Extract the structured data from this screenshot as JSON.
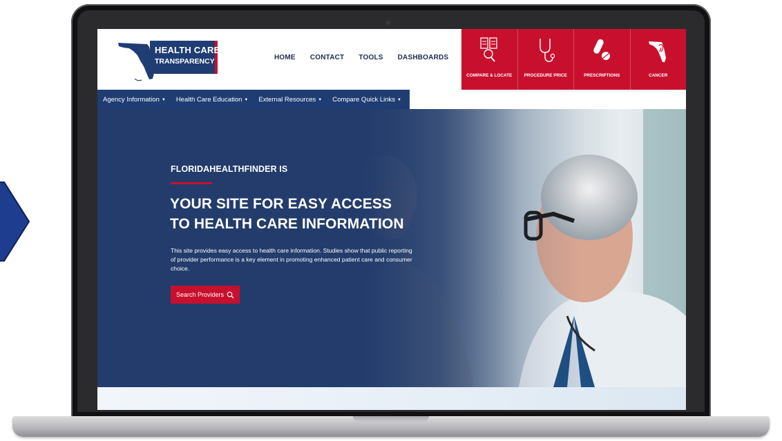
{
  "header": {
    "logo": {
      "line1": "HEALTH CARE",
      "line2": "TRANSPARENCY"
    },
    "nav": [
      "HOME",
      "CONTACT",
      "TOOLS",
      "DASHBOARDS"
    ],
    "quick_links": [
      {
        "label": "COMPARE & LOCATE",
        "icon": "compare-locate-icon"
      },
      {
        "label": "PROCEDURE PRICE",
        "icon": "stethoscope-icon"
      },
      {
        "label": "PRESCRIPTIONS",
        "icon": "pill-icon"
      },
      {
        "label": "CANCER",
        "icon": "florida-ribbon-icon"
      }
    ]
  },
  "subnav": [
    {
      "label": "Agency Information"
    },
    {
      "label": "Health Care Education"
    },
    {
      "label": "External Resources"
    },
    {
      "label": "Compare Quick Links"
    }
  ],
  "hero": {
    "kicker": "FLORIDAHEALTHFINDER IS",
    "headline_line1": "YOUR SITE FOR EASY ACCESS",
    "headline_line2": "TO HEALTH CARE INFORMATION",
    "description": "This site provides easy access to health care information. Studies show that public reporting of provider performance is a key element in promoting enhanced patient care and consumer choice.",
    "button_label": "Search Providers"
  },
  "colors": {
    "navy": "#1f3d73",
    "red": "#c8102e",
    "hero_bg": "#233c6c"
  }
}
